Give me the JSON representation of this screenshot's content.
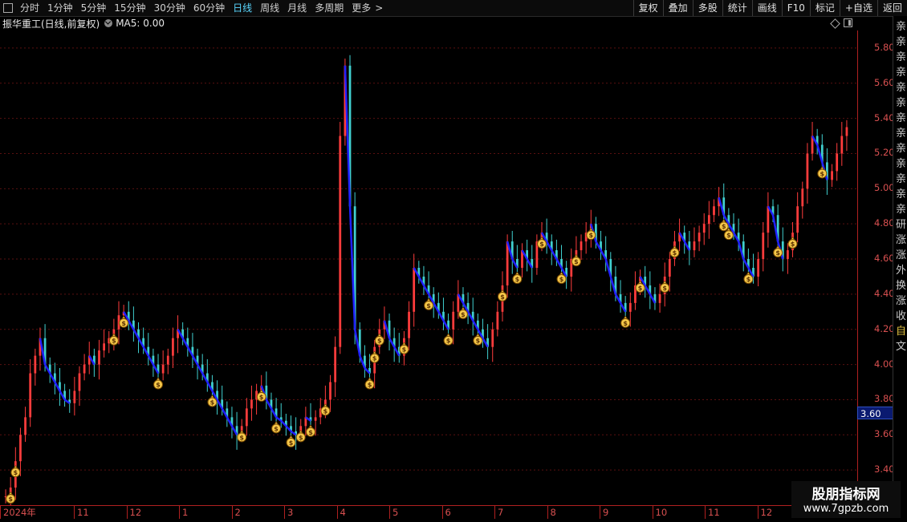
{
  "toolbar": {
    "period_tabs": [
      "分时",
      "1分钟",
      "5分钟",
      "15分钟",
      "30分钟",
      "60分钟",
      "日线",
      "周线",
      "月线",
      "多周期",
      "更多"
    ],
    "active_tab": "日线",
    "more_chevron": ">",
    "right_tools": [
      "复权",
      "叠加",
      "多股",
      "统计",
      "画线",
      "F10",
      "标记",
      "+自选",
      "返回"
    ]
  },
  "title": {
    "stock": "振华重工(日线,前复权)",
    "ma_label": "MA5: 0.00"
  },
  "yaxis": {
    "ticks": [
      "5.80",
      "5.60",
      "5.40",
      "5.20",
      "5.00",
      "4.80",
      "4.60",
      "4.40",
      "4.20",
      "4.00",
      "3.80",
      "3.60",
      "3.40"
    ],
    "current_price": "3.60"
  },
  "xaxis": {
    "labels": [
      "2024年",
      "11",
      "12",
      "1",
      "2",
      "3",
      "4",
      "5",
      "6",
      "7",
      "8",
      "9",
      "10",
      "11",
      "12"
    ]
  },
  "right_strip": {
    "chars": [
      "亲",
      "亲",
      "亲",
      "亲",
      "亲",
      "亲",
      "亲",
      "亲",
      "亲",
      "亲",
      "亲",
      "亲",
      "亲",
      "研",
      "涨",
      "涨",
      "外",
      "换",
      "涨",
      "收",
      "自",
      "文"
    ]
  },
  "watermark": {
    "line1": "股朋指标网",
    "line2": "www.7gpzb.com"
  },
  "chart_data": {
    "type": "candlestick",
    "ylim": [
      3.2,
      5.9
    ],
    "colors": {
      "up": "#ff3c3c",
      "down": "#40d0d0",
      "trend": "#2020ff",
      "grid": "#5a1010"
    },
    "closes": [
      3.25,
      3.3,
      3.45,
      3.6,
      3.7,
      3.95,
      4.05,
      4.15,
      4.0,
      3.95,
      3.9,
      3.85,
      3.8,
      3.78,
      3.85,
      3.95,
      4.0,
      4.05,
      4.0,
      4.08,
      4.12,
      4.15,
      4.2,
      4.28,
      4.3,
      4.25,
      4.2,
      4.15,
      4.1,
      4.05,
      4.0,
      3.95,
      4.0,
      4.05,
      4.15,
      4.2,
      4.15,
      4.1,
      4.05,
      4.0,
      3.95,
      3.9,
      3.85,
      3.8,
      3.75,
      3.7,
      3.65,
      3.6,
      3.65,
      3.75,
      3.8,
      3.85,
      3.88,
      3.8,
      3.75,
      3.7,
      3.68,
      3.65,
      3.62,
      3.6,
      3.65,
      3.7,
      3.68,
      3.7,
      3.75,
      3.8,
      3.9,
      4.1,
      5.3,
      5.7,
      4.9,
      4.2,
      4.05,
      3.98,
      3.95,
      4.1,
      4.2,
      4.25,
      4.15,
      4.1,
      4.05,
      4.15,
      4.3,
      4.55,
      4.5,
      4.45,
      4.4,
      4.35,
      4.3,
      4.25,
      4.2,
      4.3,
      4.4,
      4.35,
      4.3,
      4.25,
      4.2,
      4.15,
      4.1,
      4.2,
      4.3,
      4.45,
      4.7,
      4.6,
      4.55,
      4.65,
      4.6,
      4.55,
      4.7,
      4.75,
      4.7,
      4.65,
      4.6,
      4.55,
      4.5,
      4.6,
      4.65,
      4.7,
      4.75,
      4.8,
      4.7,
      4.65,
      4.6,
      4.5,
      4.4,
      4.35,
      4.3,
      4.35,
      4.45,
      4.5,
      4.45,
      4.4,
      4.35,
      4.4,
      4.5,
      4.6,
      4.7,
      4.75,
      4.7,
      4.65,
      4.7,
      4.75,
      4.8,
      4.85,
      4.9,
      4.95,
      4.85,
      4.8,
      4.75,
      4.7,
      4.6,
      4.55,
      4.5,
      4.6,
      4.75,
      4.9,
      4.85,
      4.7,
      4.6,
      4.65,
      4.75,
      4.9,
      5.0,
      5.2,
      5.3,
      5.25,
      5.15,
      5.05,
      5.1,
      5.2,
      5.3,
      5.35
    ],
    "signal_bars": [
      1,
      2,
      22,
      24,
      31,
      42,
      48,
      52,
      55,
      58,
      60,
      62,
      65,
      74,
      75,
      76,
      81,
      86,
      90,
      93,
      96,
      101,
      104,
      109,
      113,
      116,
      119,
      126,
      129,
      134,
      136,
      146,
      147,
      151,
      157,
      160,
      166
    ]
  }
}
